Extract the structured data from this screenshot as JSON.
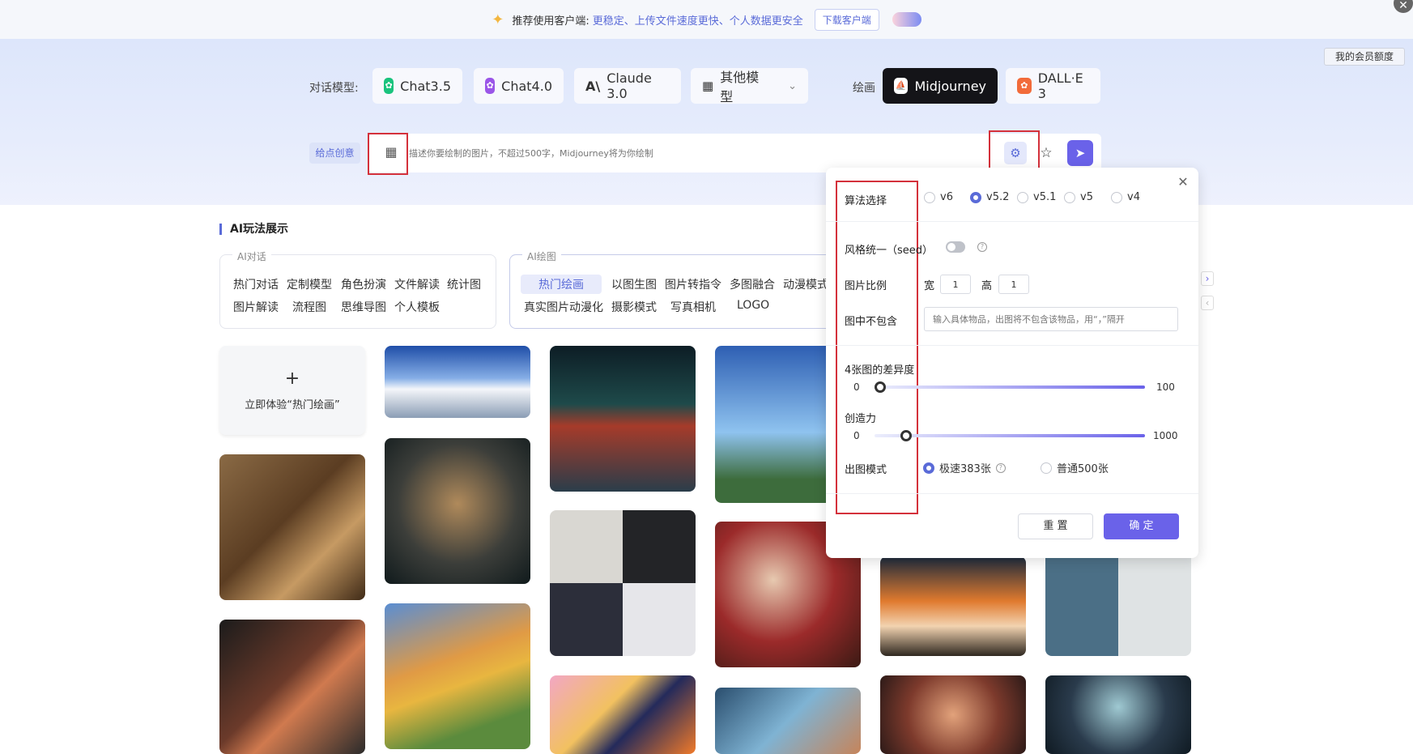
{
  "banner": {
    "label": "推荐使用客户端:",
    "benefits": "更稳定、上传文件速度更快、个人数据更安全",
    "download": "下载客户端"
  },
  "header": {
    "member_quota": "我的会员额度"
  },
  "models": {
    "chat_label": "对话模型:",
    "draw_label": "绘画",
    "chat3": "Chat3.5",
    "chat4": "Chat4.0",
    "claude": "Claude 3.0",
    "other": "其他模型",
    "midjourney": "Midjourney",
    "dalle": "DALL·E 3"
  },
  "prompt": {
    "idea_button": "给点创意",
    "placeholder": "描述你要绘制的图片，不超过500字，Midjourney将为你绘制"
  },
  "showcase": {
    "title": "AI玩法展示",
    "chat_group": {
      "legend": "AI对话",
      "tags": [
        "热门对话",
        "定制模型",
        "角色扮演",
        "文件解读",
        "统计图",
        "图片解读",
        "流程图",
        "思维导图",
        "个人模板"
      ]
    },
    "draw_group": {
      "legend": "AI绘图",
      "tags": [
        "热门绘画",
        "以图生图",
        "图片转指令",
        "多图融合",
        "动漫模式",
        "真实图片动漫化",
        "摄影模式",
        "写真相机",
        "LOGO"
      ]
    },
    "add_card": "立即体验“热门绘画”"
  },
  "panel": {
    "algo_label": "算法选择",
    "algo_options": [
      "v6",
      "v5.2",
      "v5.1",
      "v5",
      "v4"
    ],
    "algo_selected": "v5.2",
    "style_label": "风格统一（seed）",
    "style_enabled": false,
    "ratio_label": "图片比例",
    "width_label": "宽",
    "width_value": "1",
    "height_label": "高",
    "height_value": "1",
    "exclude_label": "图中不包含",
    "exclude_placeholder": "输入具体物品，出图将不包含该物品，用“，”隔开",
    "diff_label": "4张图的差异度",
    "diff_min": "0",
    "diff_max": "100",
    "diff_value": 0,
    "creat_label": "创造力",
    "creat_min": "0",
    "creat_max": "1000",
    "creat_value": 100,
    "mode_label": "出图模式",
    "mode_fast": "极速383张",
    "mode_normal": "普通500张",
    "mode_selected": "fast",
    "reset": "重 置",
    "confirm": "确 定"
  },
  "colors": {
    "accent": "#6a62e9",
    "highlight_box": "#d4313b"
  }
}
